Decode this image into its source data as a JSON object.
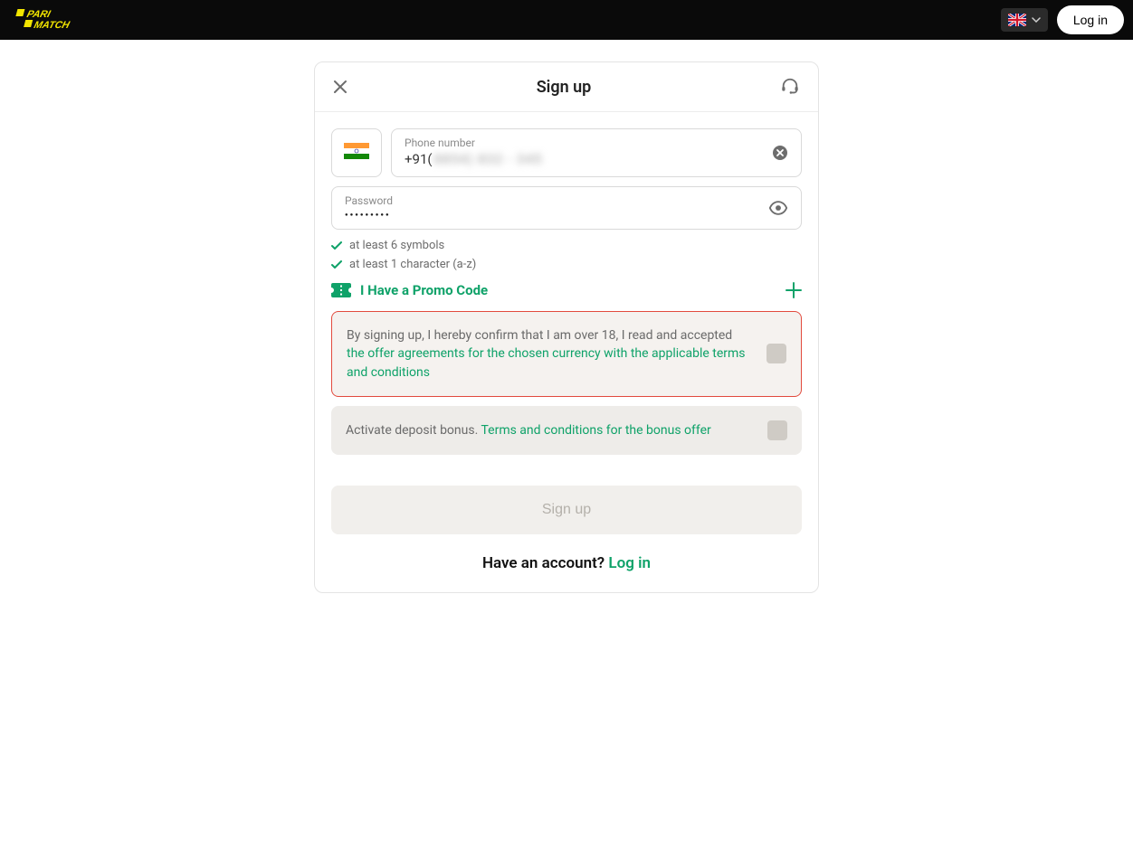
{
  "topbar": {
    "login_label": "Log in"
  },
  "card": {
    "title": "Sign up",
    "phone": {
      "label": "Phone number",
      "prefix": "+91(",
      "masked": "8854) 832 - 345"
    },
    "password": {
      "label": "Password",
      "value": "●●●●●●●●●"
    },
    "rules": [
      "at least 6 symbols",
      "at least 1 character (a-z)"
    ],
    "promo_label": "I Have a Promo Code",
    "agree": {
      "prefix": "By signing up, I hereby confirm that I am over 18, I read and accepted ",
      "link": "the offer agreements for the chosen currency with the applicable terms and conditions"
    },
    "bonus": {
      "prefix": "Activate deposit bonus. ",
      "link": "Terms and conditions for the bonus offer"
    },
    "signup_label": "Sign up",
    "have_account_prefix": "Have an account? ",
    "have_account_link": "Log in"
  }
}
